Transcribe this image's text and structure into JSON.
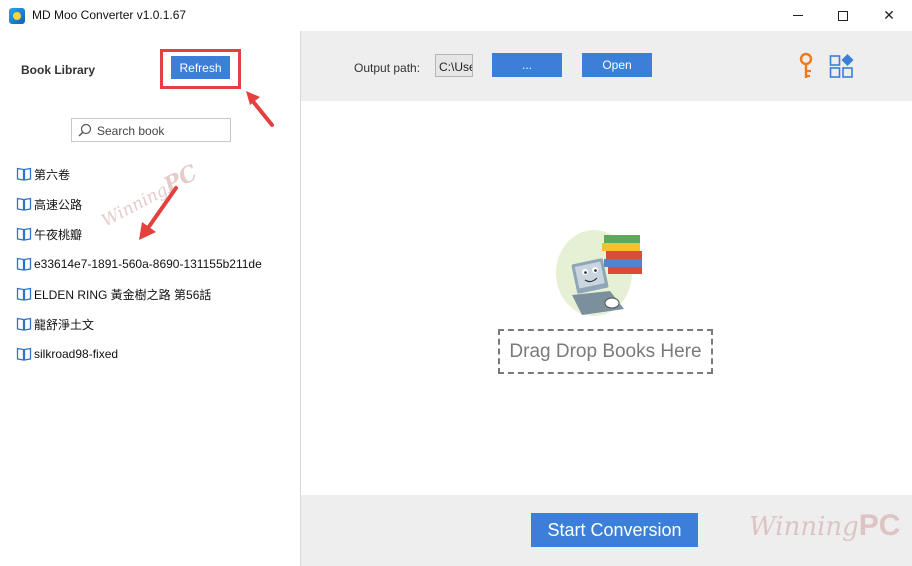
{
  "window": {
    "title": "MD Moo Converter v1.0.1.67",
    "minimize_glyph": "",
    "maximize_glyph": "",
    "close_glyph": "✕"
  },
  "sidebar": {
    "title": "Book Library",
    "refresh_label": "Refresh",
    "search_placeholder": "Search book",
    "books": [
      "第六卷",
      "高速公路",
      "午夜桃瓣",
      "e33614e7-1891-560a-8690-131155b211de",
      "ELDEN RING 黃金樹之路 第56話",
      "龍舒淨土文",
      "silkroad98-fixed"
    ]
  },
  "toolbar": {
    "output_label": "Output path:",
    "output_value": "C:\\Users",
    "browse_label": "...",
    "open_label": "Open",
    "key_icon": "key-icon",
    "apps_icon": "apps-icon"
  },
  "dropzone": {
    "label": "Drag Drop Books Here"
  },
  "footer": {
    "start_label": "Start Conversion"
  },
  "watermarks": {
    "sidebar_text_a": "Winning",
    "sidebar_text_b": "PC",
    "footer_text_a": "Winning",
    "footer_text_b": "PC"
  },
  "colors": {
    "accent": "#3b7fd8",
    "annotation": "#e34040",
    "book_icon": "#2f72c9"
  }
}
